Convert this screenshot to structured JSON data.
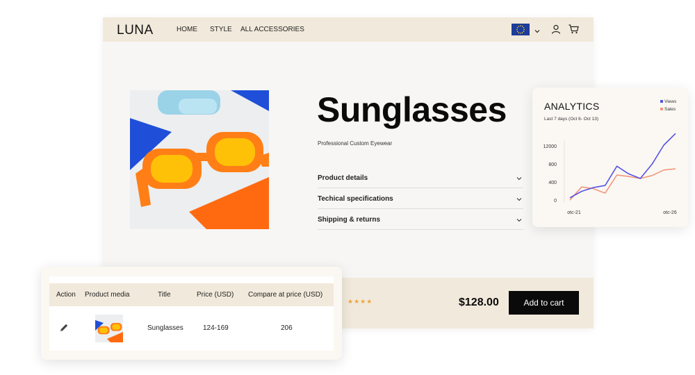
{
  "store": {
    "logo": "LUNA",
    "nav": [
      {
        "label": "HOME"
      },
      {
        "label": "STYLE"
      },
      {
        "label": "ALL ACCESSORIES"
      }
    ],
    "region_flag": "eu-flag",
    "icons": [
      "chevron-down-icon",
      "user-icon",
      "cart-icon"
    ]
  },
  "product": {
    "title": "Sunglasses",
    "subtitle": "Professional Custom Eyewear",
    "accordions": [
      {
        "label": "Product details"
      },
      {
        "label": "Techical specifications"
      },
      {
        "label": "Shipping & returns"
      }
    ],
    "rating_stars": "★★★★",
    "price": "$128.00",
    "add_to_cart": "Add to cart"
  },
  "analytics": {
    "title": "ANALYTICS",
    "subtitle": "Last 7 days (Oct 6- Oct 13)",
    "chart_data": {
      "type": "line",
      "title": "ANALYTICS",
      "subtitle": "Last 7 days (Oct 6- Oct 13)",
      "y_tick_labels": [
        "0",
        "400",
        "800",
        "12000"
      ],
      "x_tick_labels": [
        "otc-21",
        "otc-26"
      ],
      "x": [
        1,
        2,
        3,
        4,
        5,
        6,
        7,
        8,
        9,
        10
      ],
      "series": [
        {
          "name": "Views",
          "color": "#5552e6",
          "values": [
            100,
            320,
            450,
            520,
            1180,
            920,
            760,
            1250,
            1900,
            2300
          ]
        },
        {
          "name": "Sales",
          "color": "#f2967a",
          "values": [
            20,
            470,
            410,
            260,
            880,
            830,
            760,
            860,
            1050,
            1090
          ]
        }
      ],
      "legend_position": "top-right",
      "grid": false
    }
  },
  "table": {
    "headers": [
      "Action",
      "Product media",
      "Title",
      "Price (USD)",
      "Compare at price (USD)"
    ],
    "rows": [
      {
        "action_icon": "pencil-icon",
        "media": "sunglasses-thumbnail",
        "title": "Sunglasses",
        "price": "124-169",
        "compare": "206"
      }
    ]
  }
}
